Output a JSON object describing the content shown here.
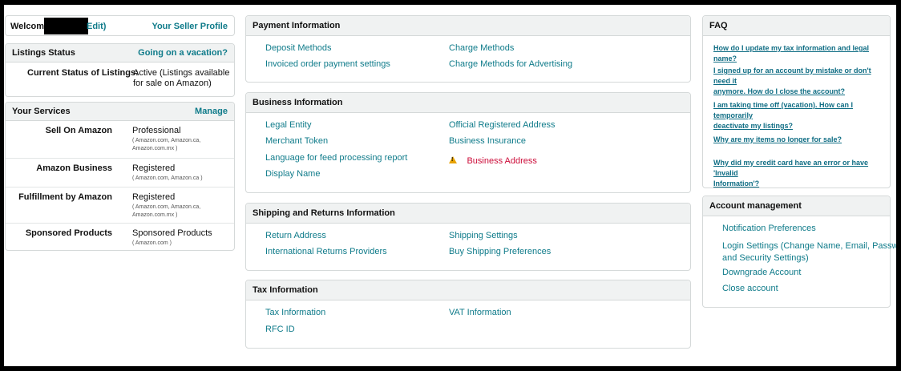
{
  "welcome": {
    "prefix": "Welcome",
    "edit": "Edit)",
    "seller_profile": "Your Seller Profile"
  },
  "listings_status": {
    "title": "Listings Status",
    "vacation_link": "Going on a vacation?",
    "current_label": "Current Status of Listings:",
    "current_value_line1": "Active (Listings available",
    "current_value_line2": "for sale on Amazon)"
  },
  "services": {
    "title": "Your Services",
    "manage": "Manage",
    "items": [
      {
        "label": "Sell On Amazon",
        "value": "Professional",
        "sub1": "( Amazon.com, Amazon.ca,",
        "sub2": "Amazon.com.mx )"
      },
      {
        "label": "Amazon Business",
        "value": "Registered",
        "sub1": "( Amazon.com, Amazon.ca )",
        "sub2": ""
      },
      {
        "label": "Fulfillment by Amazon",
        "value": "Registered",
        "sub1": "( Amazon.com, Amazon.ca,",
        "sub2": "Amazon.com.mx )"
      },
      {
        "label": "Sponsored Products",
        "value": "Sponsored Products",
        "sub1": "( Amazon.com )",
        "sub2": ""
      }
    ]
  },
  "payment": {
    "title": "Payment Information",
    "links": [
      "Deposit Methods",
      "Charge Methods",
      "Invoiced order payment settings",
      "Charge Methods for Advertising"
    ]
  },
  "business": {
    "title": "Business Information",
    "links": [
      "Legal Entity",
      "Official Registered Address",
      "Merchant Token",
      "Business Insurance",
      "Language for feed processing report",
      "Business Address",
      "Display Name"
    ]
  },
  "shipping": {
    "title": "Shipping and Returns Information",
    "links": [
      "Return Address",
      "Shipping Settings",
      "International Returns Providers",
      "Buy Shipping Preferences"
    ]
  },
  "tax": {
    "title": "Tax Information",
    "links": [
      "Tax Information",
      "VAT Information",
      "RFC ID"
    ]
  },
  "faq": {
    "title": "FAQ",
    "items": [
      {
        "line1": "How do I update my tax information and legal name?",
        "line2": ""
      },
      {
        "line1": "I signed up for an account by mistake or don't need it",
        "line2": "anymore. How do I close the account?"
      },
      {
        "line1": "I am taking time off (vacation). How can I temporarily",
        "line2": "deactivate my listings?"
      },
      {
        "line1": "Why are my items no longer for sale?",
        "line2": ""
      },
      {
        "line1": "Why did my credit card have an error or have 'Invalid",
        "line2": "Information'?"
      }
    ]
  },
  "account": {
    "title": "Account management",
    "links": [
      {
        "line1": "Notification Preferences",
        "line2": ""
      },
      {
        "line1": "Login Settings (Change Name, Email, Password",
        "line2": "and Security Settings)"
      },
      {
        "line1": "Downgrade Account",
        "line2": ""
      },
      {
        "line1": "Close account",
        "line2": ""
      }
    ]
  },
  "colors": {
    "link": "#0f7b8a",
    "warning_link": "#cc0c39",
    "header_bg": "#f0f2f2"
  }
}
